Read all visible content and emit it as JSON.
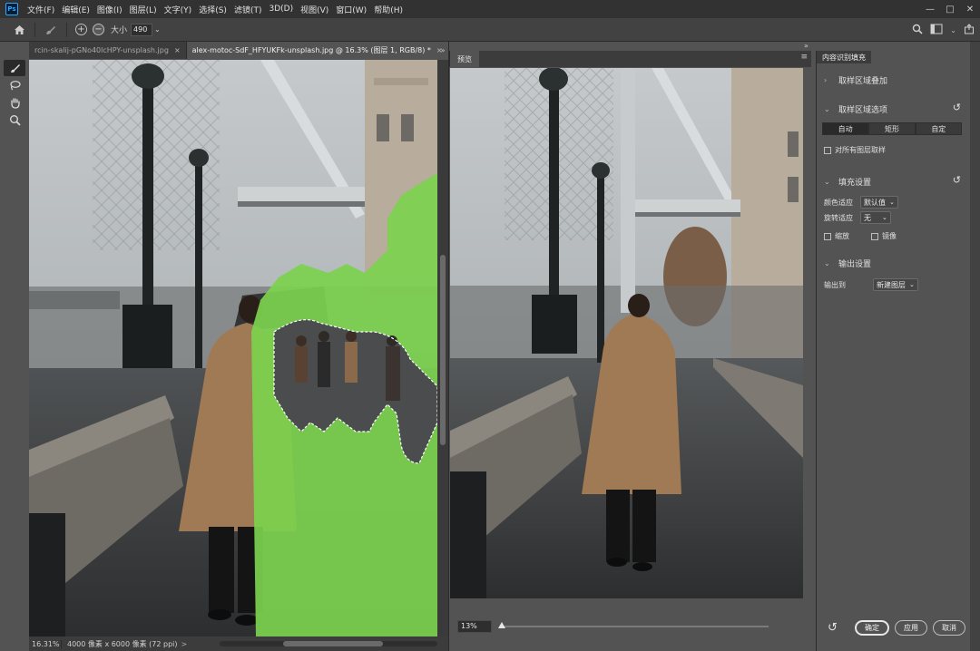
{
  "app": {
    "logo": "Ps",
    "menu": [
      "文件(F)",
      "编辑(E)",
      "图像(I)",
      "图层(L)",
      "文字(Y)",
      "选择(S)",
      "滤镜(T)",
      "3D(D)",
      "视图(V)",
      "窗口(W)",
      "帮助(H)"
    ],
    "window_controls": [
      "—",
      "□",
      "✕"
    ]
  },
  "options_bar": {
    "size_label": "大小",
    "size_value": "490"
  },
  "tools": [
    "brush-icon",
    "lasso-icon",
    "hand-icon",
    "zoom-icon"
  ],
  "document_tabs": [
    {
      "label": "rcin-skalij-pGNo40lcHPY-unsplash.jpg",
      "close": "×",
      "active": false
    },
    {
      "label": "alex-motoc-SdF_HFYUKFk-unsplash.jpg @ 16.3% (图层 1, RGB/8) *",
      "close": "×",
      "active": true
    }
  ],
  "status_bar": {
    "zoom": "16.31%",
    "info": "4000 像素 x 6000 像素 (72 ppi)",
    "arrow": ">"
  },
  "preview": {
    "tab": "预览",
    "zoom": "13%",
    "zoom_fraction": 0.0
  },
  "panel": {
    "tab": "内容识别填充",
    "sections": {
      "sampling_overlay": "取样区域叠加",
      "sampling_options": "取样区域选项",
      "fill_settings": "填充设置",
      "output_settings": "输出设置"
    },
    "sampling_modes": [
      "自动",
      "矩形",
      "自定"
    ],
    "sampling_active": "自动",
    "sample_all_layers": "对所有图层取样",
    "color_adapt_label": "颜色适应",
    "color_adapt_value": "默认值",
    "rotation_adapt_label": "旋转适应",
    "rotation_adapt_value": "无",
    "scale_label": "缩放",
    "mirror_label": "镜像",
    "output_to_label": "输出到",
    "output_to_value": "新建图层",
    "buttons": {
      "ok": "确定",
      "apply": "应用",
      "cancel": "取消"
    }
  }
}
